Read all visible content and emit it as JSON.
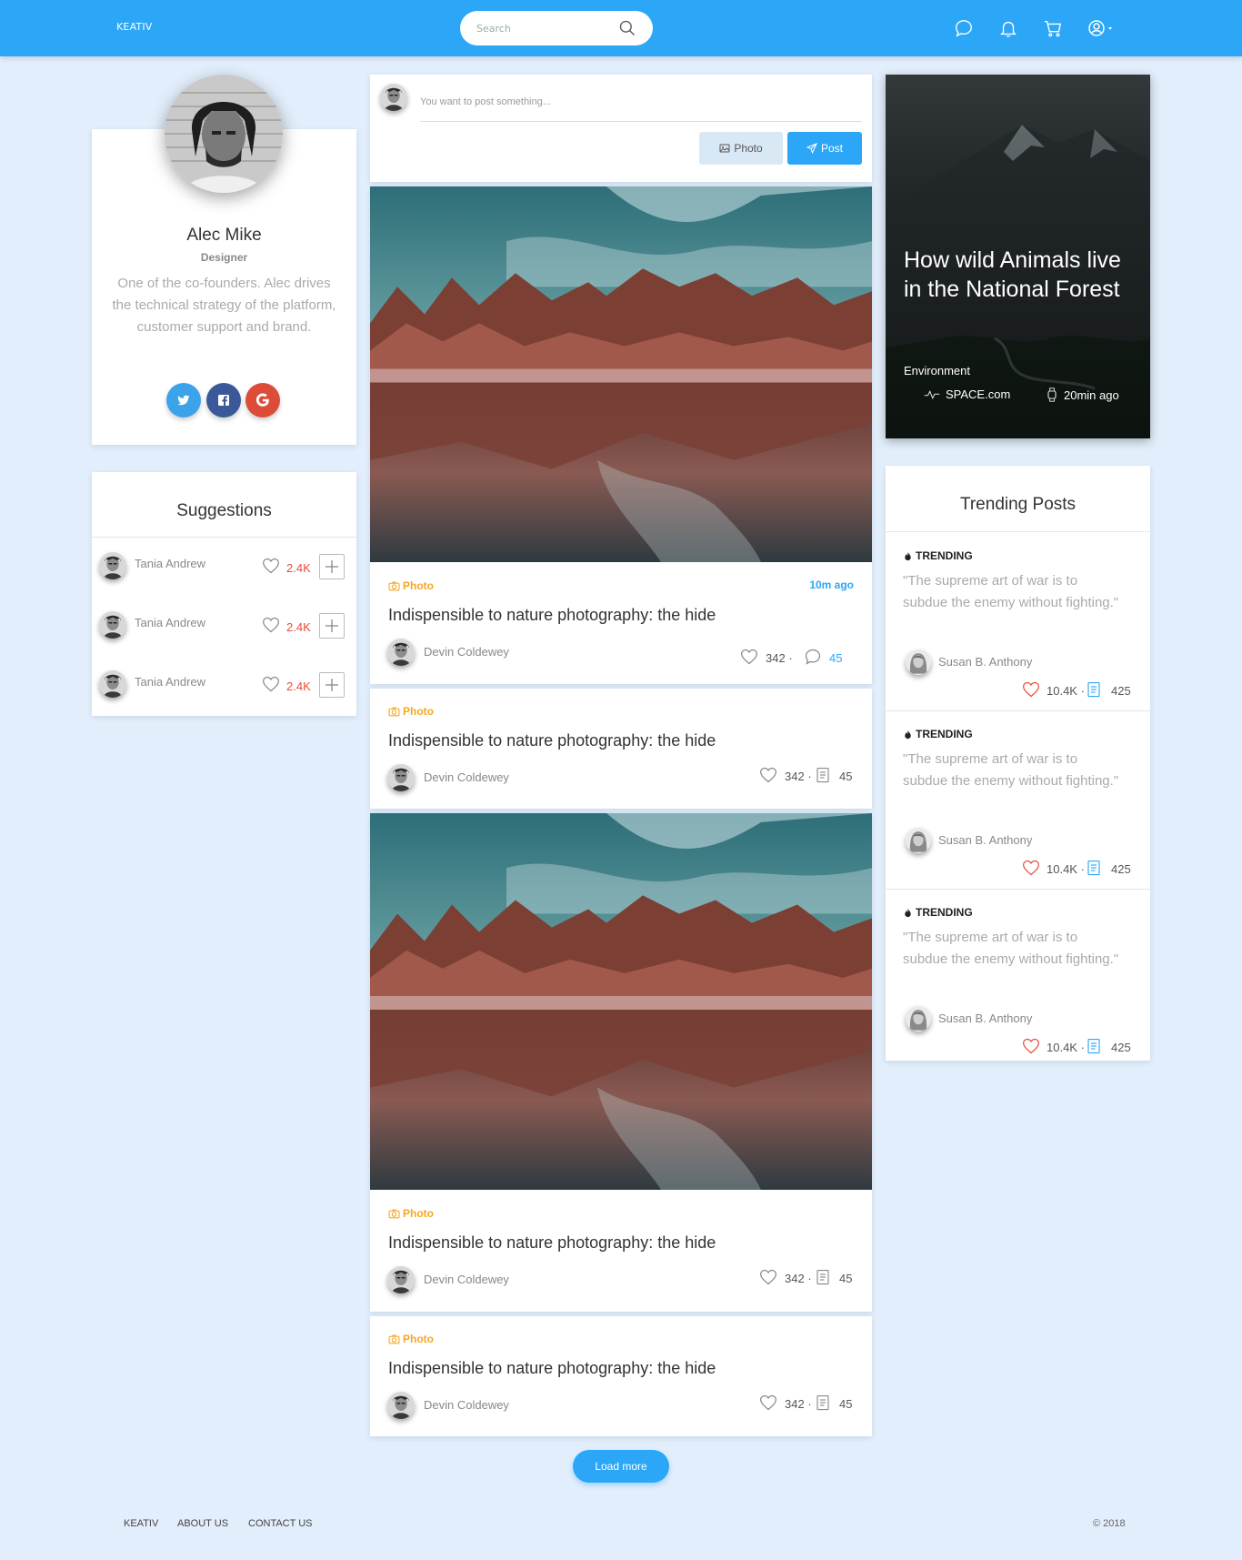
{
  "header": {
    "brand": "KEATIV",
    "search_placeholder": "Search",
    "icons": [
      "chat-icon",
      "bell-icon",
      "cart-icon",
      "user-icon"
    ]
  },
  "profile": {
    "name": "Alec Mike",
    "role": "Designer",
    "bio": "One of the co-founders. Alec drives the technical strategy of the platform, customer support and brand.",
    "social": [
      "twitter-icon",
      "facebook-icon",
      "google-icon"
    ]
  },
  "suggestions": {
    "title": "Suggestions",
    "items": [
      {
        "name": "Tania Andrew",
        "likes": "2.4K"
      },
      {
        "name": "Tania Andrew",
        "likes": "2.4K"
      },
      {
        "name": "Tania Andrew",
        "likes": "2.4K"
      }
    ]
  },
  "composer": {
    "placeholder": "You want to post something...",
    "photo_label": "Photo",
    "post_label": "Post"
  },
  "posts": [
    {
      "tag": "Photo",
      "time": "10m ago",
      "title": "Indispensible to nature photography: the hide",
      "author": "Devin Coldewey",
      "likes": "342",
      "comments": "45"
    },
    {
      "tag": "Photo",
      "title": "Indispensible to nature photography: the hide",
      "author": "Devin Coldewey",
      "likes": "342",
      "comments": "45"
    },
    {
      "tag": "Photo",
      "title": "Indispensible to nature photography: the hide",
      "author": "Devin Coldewey",
      "likes": "342",
      "comments": "45"
    },
    {
      "tag": "Photo",
      "title": "Indispensible to nature photography: the hide",
      "author": "Devin Coldewey",
      "likes": "342",
      "comments": "45"
    }
  ],
  "load_more": "Load more",
  "feature": {
    "title": "How wild Animals live in the National Forest",
    "category": "Environment",
    "source": "SPACE.com",
    "time": "20min ago"
  },
  "trending": {
    "title": "Trending Posts",
    "items": [
      {
        "label": "TRENDING",
        "quote": "\"The supreme art of war is to subdue the enemy without fighting.\"",
        "author": "Susan B. Anthony",
        "likes": "10.4K",
        "count": "425"
      },
      {
        "label": "TRENDING",
        "quote": "\"The supreme art of war is to subdue the enemy without fighting.\"",
        "author": "Susan B. Anthony",
        "likes": "10.4K",
        "count": "425"
      },
      {
        "label": "TRENDING",
        "quote": "\"The supreme art of war is to subdue the enemy without fighting.\"",
        "author": "Susan B. Anthony",
        "likes": "10.4K",
        "count": "425"
      }
    ]
  },
  "footer": {
    "links": [
      "KEATIV",
      "ABOUT US",
      "CONTACT US"
    ],
    "copyright": "© 2018"
  },
  "colors": {
    "primary": "#2ca6f7",
    "background": "#e2eefb",
    "like": "#e74c3c",
    "photo_tag": "#f5a623",
    "twitter": "#3ba3ea",
    "facebook": "#3b5998",
    "google": "#dd4b39"
  }
}
